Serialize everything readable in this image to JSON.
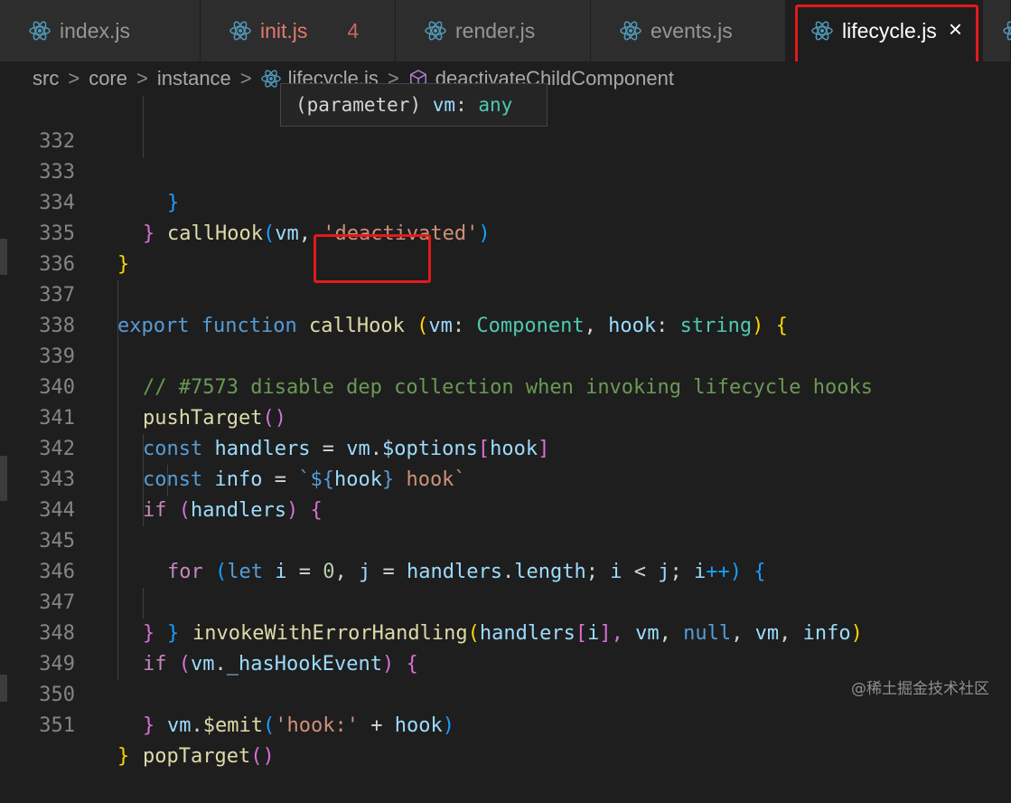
{
  "tabs": [
    {
      "label": "index.js",
      "active": false
    },
    {
      "label": "init.js",
      "badge": "4",
      "active": false
    },
    {
      "label": "render.js",
      "active": false
    },
    {
      "label": "events.js",
      "active": false
    },
    {
      "label": "lifecycle.js",
      "active": true,
      "close_icon": "×"
    }
  ],
  "breadcrumb": {
    "items": [
      "src",
      "core",
      "instance",
      "lifecycle.js",
      "deactivateChildComponent"
    ],
    "separator": ">"
  },
  "tooltip": {
    "paren_open": "(",
    "kind": "parameter",
    "paren_close": ")",
    "name": "vm",
    "colon": ":",
    "type": "any"
  },
  "colors": {
    "keyword": "#569cd6",
    "function": "#dcdcaa",
    "variable": "#9cdcfe",
    "string": "#ce9178",
    "comment": "#6a9955",
    "type": "#4ec9b0",
    "highlight_box": "#e3191c"
  },
  "code": {
    "lines": [
      {
        "num": "332",
        "t": [
          "}"
        ]
      },
      {
        "num": "333",
        "t": [
          "callHook",
          "(",
          "vm",
          ", ",
          "'deactivated'",
          ")"
        ]
      },
      {
        "num": "334",
        "t": [
          "}"
        ]
      },
      {
        "num": "335",
        "t": [
          "}"
        ]
      },
      {
        "num": "336",
        "t": []
      },
      {
        "num": "337",
        "t": [
          "export",
          " ",
          "function",
          " ",
          "callHook",
          " ",
          "(",
          "vm",
          ": ",
          "Component",
          ", ",
          "hook",
          ": ",
          "string",
          ") ",
          "{"
        ]
      },
      {
        "num": "338",
        "t": [
          "// #7573 disable dep collection when invoking lifecycle hooks"
        ]
      },
      {
        "num": "339",
        "t": [
          "pushTarget",
          "()"
        ]
      },
      {
        "num": "340",
        "t": [
          "const",
          " ",
          "handlers",
          " = ",
          "vm",
          ".",
          "$options",
          "[",
          "hook",
          "]"
        ]
      },
      {
        "num": "341",
        "t": [
          "const",
          " ",
          "info",
          " = ",
          "`${",
          "hook",
          "}",
          " hook`"
        ]
      },
      {
        "num": "342",
        "t": [
          "if",
          " (",
          "handlers",
          ") ",
          "{"
        ]
      },
      {
        "num": "343",
        "t": [
          "for",
          " (",
          "let",
          " ",
          "i",
          " = ",
          "0",
          ", ",
          "j",
          " = ",
          "handlers",
          ".",
          "length",
          "; ",
          "i",
          " < ",
          "j",
          "; ",
          "i",
          "++) ",
          "{"
        ]
      },
      {
        "num": "344",
        "t": [
          "invokeWithErrorHandling",
          "(",
          "handlers",
          "[",
          "i",
          "], ",
          "vm",
          ", ",
          "null",
          ", ",
          "vm",
          ", ",
          "info",
          ")"
        ]
      },
      {
        "num": "345",
        "t": [
          "}"
        ]
      },
      {
        "num": "346",
        "t": [
          "}"
        ]
      },
      {
        "num": "347",
        "t": [
          "if",
          " (",
          "vm",
          ".",
          "_hasHookEvent",
          ") ",
          "{"
        ]
      },
      {
        "num": "348",
        "t": [
          "vm",
          ".",
          "$emit",
          "(",
          "'hook:'",
          " + ",
          "hook",
          ")"
        ]
      },
      {
        "num": "349",
        "t": [
          "}"
        ]
      },
      {
        "num": "350",
        "t": [
          "popTarget",
          "()"
        ]
      },
      {
        "num": "351",
        "t": [
          "}"
        ]
      }
    ]
  },
  "watermark": "@稀土掘金技术社区"
}
